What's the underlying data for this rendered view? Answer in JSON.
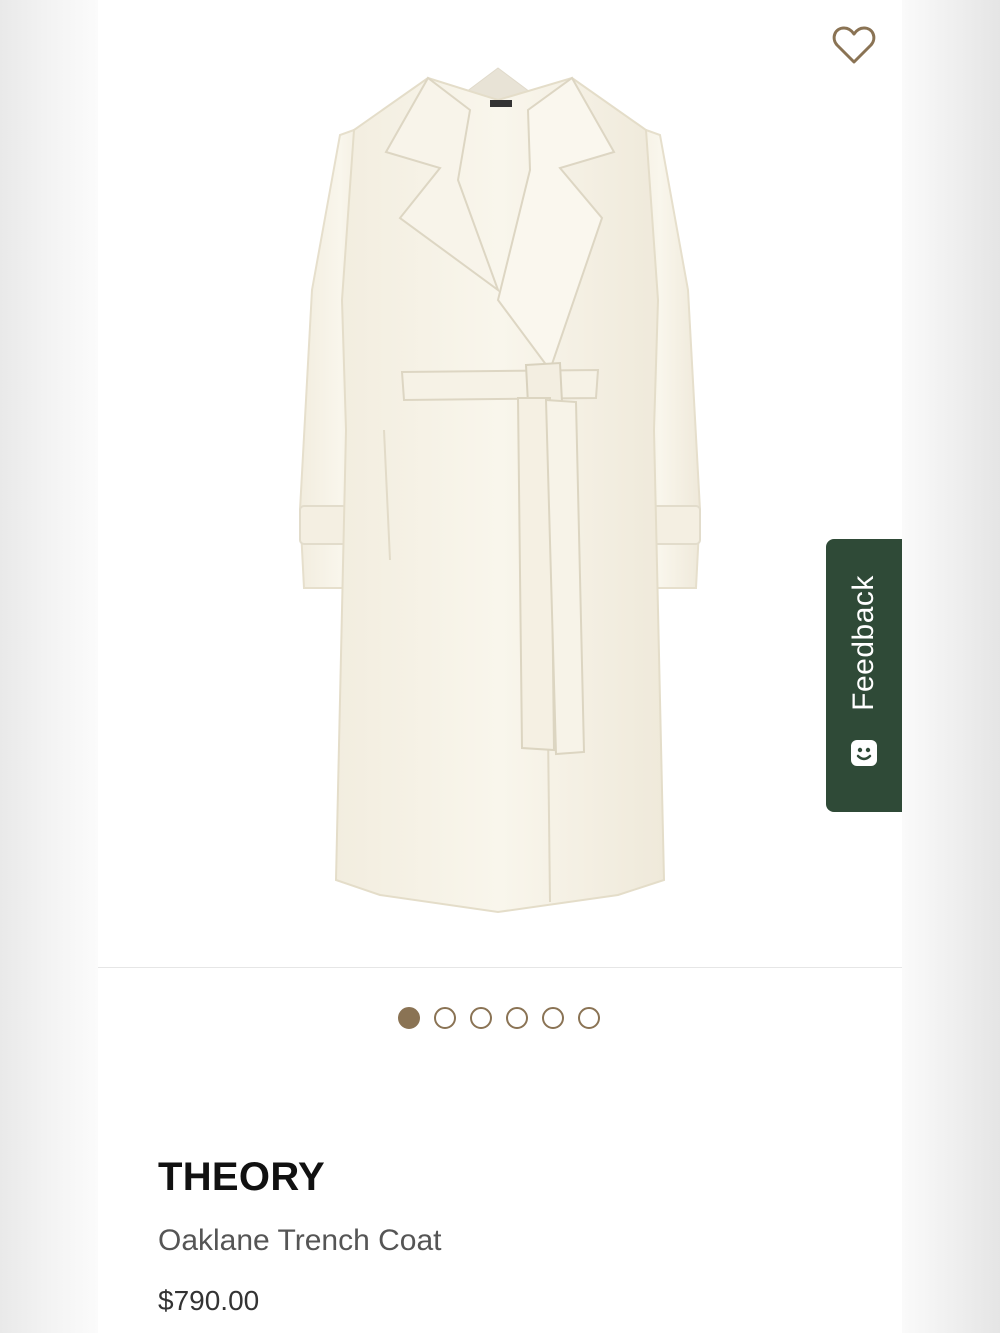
{
  "product": {
    "brand": "THEORY",
    "name": "Oaklane Trench Coat",
    "price": "$790.00",
    "image_alt": "Oaklane Trench Coat"
  },
  "gallery": {
    "image_count": 6,
    "active_index": 0,
    "wishlist_icon": "heart-outline-icon"
  },
  "feedback": {
    "label": "Feedback",
    "icon": "smiley-face-icon",
    "color": "#2f4a37"
  },
  "colors": {
    "accent": "#8a7354",
    "coat": "#f7f3e7"
  }
}
